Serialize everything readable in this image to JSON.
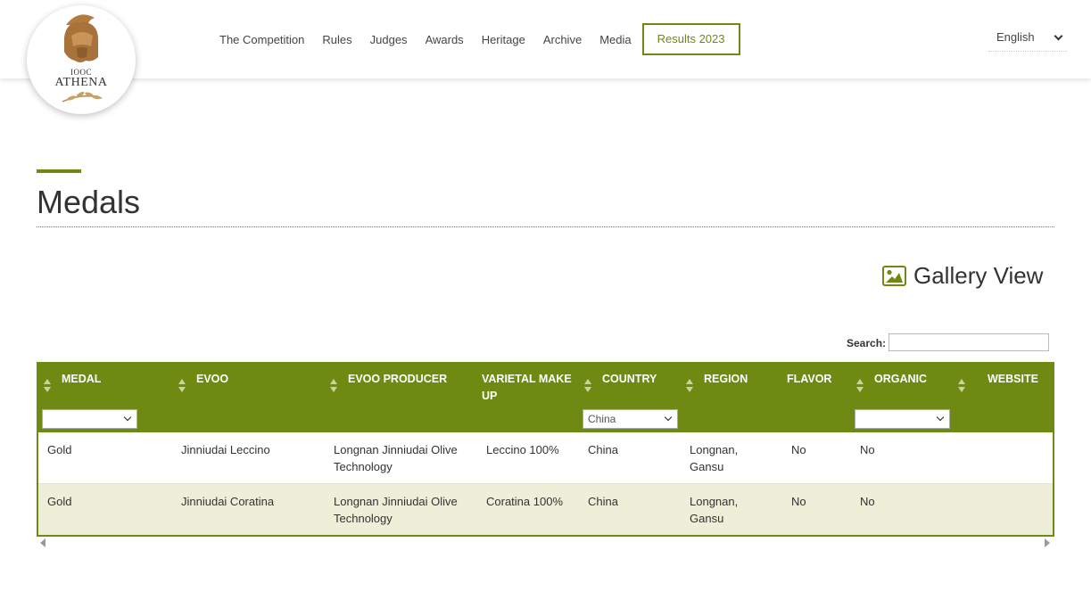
{
  "logo": {
    "small_text": "IOOC",
    "big_text": "ATHENA"
  },
  "nav": {
    "items": [
      "The Competition",
      "Rules",
      "Judges",
      "Awards",
      "Heritage",
      "Archive",
      "Media"
    ],
    "results": "Results 2023"
  },
  "language": {
    "selected": "English"
  },
  "page": {
    "title": "Medals"
  },
  "gallery": {
    "label": "Gallery View",
    "icon": "image-icon"
  },
  "search": {
    "label": "Search:",
    "value": ""
  },
  "table": {
    "columns": [
      "MEDAL",
      "EVOO",
      "EVOO PRODUCER",
      "VARIETAL MAKE UP",
      "COUNTRY",
      "REGION",
      "FLAVOR",
      "ORGANIC",
      "WEBSITE"
    ],
    "filters": {
      "medal": "",
      "country": "China",
      "organic": ""
    },
    "rows": [
      [
        "Gold",
        "Jinniudai Leccino",
        "Longnan Jinniudai Olive Technology",
        "Leccino 100%",
        "China",
        "Longnan, Gansu",
        "No",
        "No",
        ""
      ],
      [
        "Gold",
        "Jinniudai Coratina",
        "Longnan Jinniudai Olive Technology",
        "Coratina 100%",
        "China",
        "Longnan, Gansu",
        "No",
        "No",
        ""
      ]
    ]
  },
  "colors": {
    "accent": "#6e8a12",
    "row_alt": "#eeeed9",
    "logo_gold": "#b37c3c"
  }
}
